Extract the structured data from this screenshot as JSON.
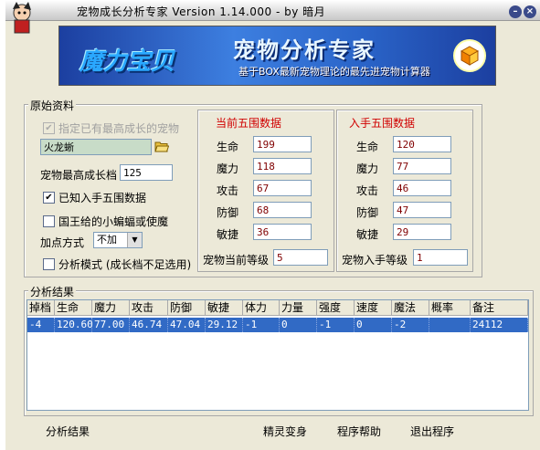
{
  "window": {
    "title": "宠物成长分析专家 Version 1.14.000 - by 暗月"
  },
  "banner": {
    "logo_text": "魔力宝贝",
    "title": "宠物分析专家",
    "subtitle": "基于BOX最新宠物理论的最先进宠物计算器"
  },
  "raw_group": {
    "label": "原始资料",
    "highest_growth_label": "指定已有最高成长的宠物",
    "pet_name": "火龙蜥",
    "max_growth_label": "宠物最高成长档",
    "max_growth_value": "125",
    "known_stats_label": "已知入手五围数据",
    "known_stats_checked": "✔",
    "king_bat_label": "国王给的小蝙蝠或使魔",
    "point_mode_label": "加点方式",
    "point_mode_value": "不加",
    "analysis_mode_label": "分析模式 (成长档不足选用)"
  },
  "current_stats": {
    "title": "当前五围数据",
    "rows": [
      {
        "label": "生命",
        "value": "199"
      },
      {
        "label": "魔力",
        "value": "118"
      },
      {
        "label": "攻击",
        "value": "67"
      },
      {
        "label": "防御",
        "value": "68"
      },
      {
        "label": "敏捷",
        "value": "36"
      }
    ],
    "level_label": "宠物当前等级",
    "level_value": "5"
  },
  "initial_stats": {
    "title": "入手五围数据",
    "rows": [
      {
        "label": "生命",
        "value": "120"
      },
      {
        "label": "魔力",
        "value": "77"
      },
      {
        "label": "攻击",
        "value": "46"
      },
      {
        "label": "防御",
        "value": "47"
      },
      {
        "label": "敏捷",
        "value": "29"
      }
    ],
    "level_label": "宠物入手等级",
    "level_value": "1"
  },
  "results": {
    "label": "分析结果",
    "columns": [
      "掉档",
      "生命",
      "魔力",
      "攻击",
      "防御",
      "敏捷",
      "体力",
      "力量",
      "强度",
      "速度",
      "魔法",
      "概率",
      "备注"
    ],
    "rows": [
      [
        "-4",
        "120.60",
        "77.00",
        "46.74",
        "47.04",
        "29.12",
        "-1",
        "0",
        "-1",
        "0",
        "-2",
        "",
        "24112"
      ]
    ]
  },
  "footer": {
    "status": "分析结果",
    "elf_transform": "精灵变身",
    "help": "程序帮助",
    "exit": "退出程序"
  },
  "colors": {
    "banner_blue": "#2a64c8",
    "selection": "#316ac5",
    "red_title": "#d00000"
  }
}
